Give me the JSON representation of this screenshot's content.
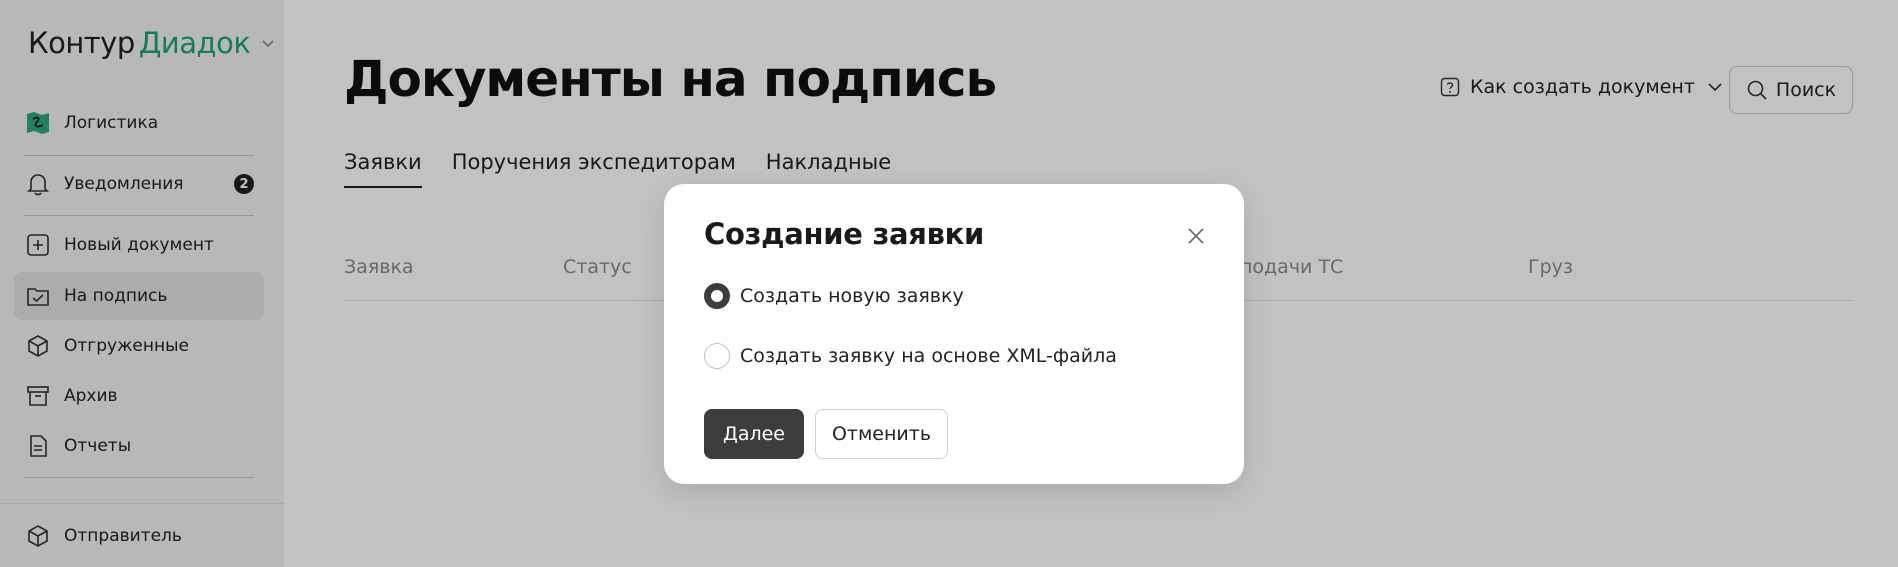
{
  "sidebar": {
    "logo_part1": "Контур",
    "logo_part2": "Диадок",
    "items": [
      {
        "label": "Логистика"
      },
      {
        "label": "Уведомления",
        "badge": "2"
      },
      {
        "label": "Новый документ"
      },
      {
        "label": "На подпись"
      },
      {
        "label": "Отгруженные"
      },
      {
        "label": "Архив"
      },
      {
        "label": "Отчеты"
      },
      {
        "label": "Отправитель"
      }
    ]
  },
  "header": {
    "title": "Документы на подпись",
    "help_label": "Как создать документ",
    "search_label": "Поиск"
  },
  "tabs": [
    {
      "label": "Заявки"
    },
    {
      "label": "Поручения экспедиторам"
    },
    {
      "label": "Накладные"
    }
  ],
  "table": {
    "columns": [
      "Заявка",
      "Статус",
      "подачи ТС",
      "Груз"
    ]
  },
  "modal": {
    "title": "Создание заявки",
    "options": [
      {
        "label": "Создать новую заявку",
        "checked": true
      },
      {
        "label": "Создать заявку на основе XML-файла",
        "checked": false
      }
    ],
    "primary_label": "Далее",
    "secondary_label": "Отменить"
  },
  "colors": {
    "brand_green": "#1fa47a",
    "primary_button": "#3d3d3d"
  }
}
